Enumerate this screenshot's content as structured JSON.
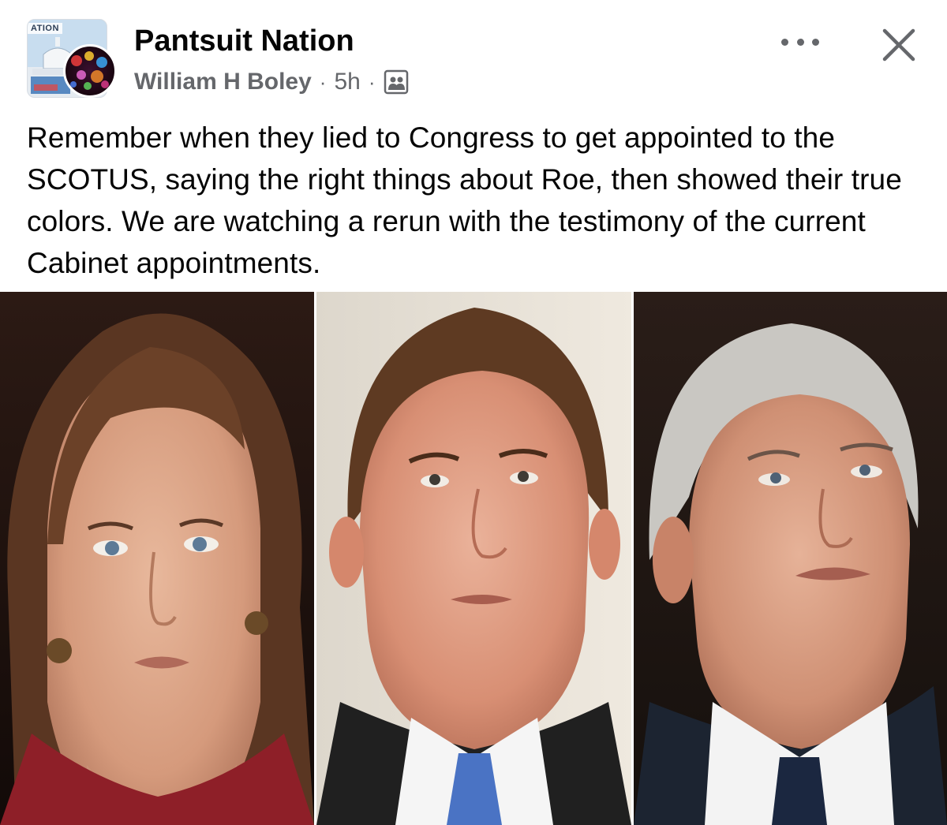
{
  "header": {
    "group_name": "Pantsuit Nation",
    "group_avatar_text": "ATION",
    "author": "William H Boley",
    "separator": "·",
    "timestamp": "5h",
    "audience_icon": "group-members-icon",
    "more_icon": "more-options-icon",
    "close_icon": "close-icon"
  },
  "post": {
    "text": "Remember when they lied to Congress to get appointed to the SCOTUS, saying the right things about Roe, then showed their true colors. We are watching a rerun with the testimony of the current Cabinet appointments."
  },
  "photo": {
    "panels": [
      "portrait-left",
      "portrait-center",
      "portrait-right"
    ]
  },
  "colors": {
    "primary_text": "#050505",
    "secondary_text": "#65676b",
    "background": "#ffffff"
  }
}
